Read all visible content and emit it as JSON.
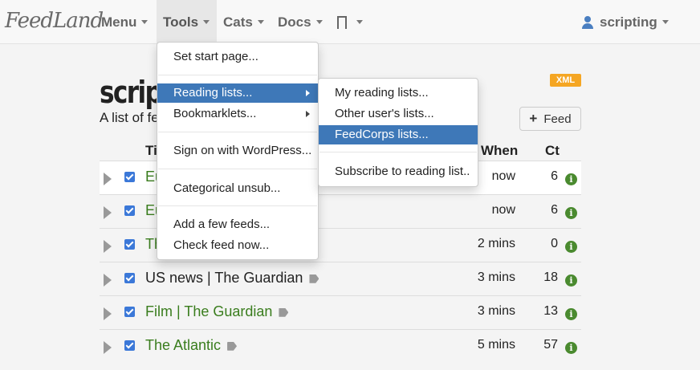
{
  "app": {
    "logo": "FeedLand"
  },
  "nav": {
    "menu": "Menu",
    "tools": "Tools",
    "cats": "Cats",
    "docs": "Docs",
    "user": "scripting"
  },
  "page": {
    "title": "scripting",
    "description": "A list of feeds",
    "xml_badge": "XML",
    "feed_button": "Feed",
    "columns": {
      "title": "Title",
      "when": "When",
      "ct": "Ct"
    }
  },
  "feeds": [
    {
      "title": "Eu",
      "when": "now",
      "ct": "6"
    },
    {
      "title": "Eu",
      "when": "now",
      "ct": "6"
    },
    {
      "title": "Th",
      "when": "2 mins",
      "ct": "0"
    },
    {
      "title": "US news | The Guardian",
      "when": "3 mins",
      "ct": "18"
    },
    {
      "title": "Film | The Guardian",
      "when": "3 mins",
      "ct": "13"
    },
    {
      "title": "The Atlantic",
      "when": "5 mins",
      "ct": "57"
    }
  ],
  "tools_menu": {
    "items": [
      "Set start page...",
      "Reading lists...",
      "Bookmarklets...",
      "Sign on with WordPress...",
      "Categorical unsub...",
      "Add a few feeds...",
      "Check feed now..."
    ]
  },
  "reading_lists_menu": {
    "items": [
      "My reading lists...",
      "Other user's lists...",
      "FeedCorps lists...",
      "Subscribe to reading list.."
    ]
  },
  "colors": {
    "accent": "#3e78b8",
    "green_title": "#3a7d1e",
    "xml_badge": "#f5a623",
    "checkbox": "#3b78d8"
  }
}
